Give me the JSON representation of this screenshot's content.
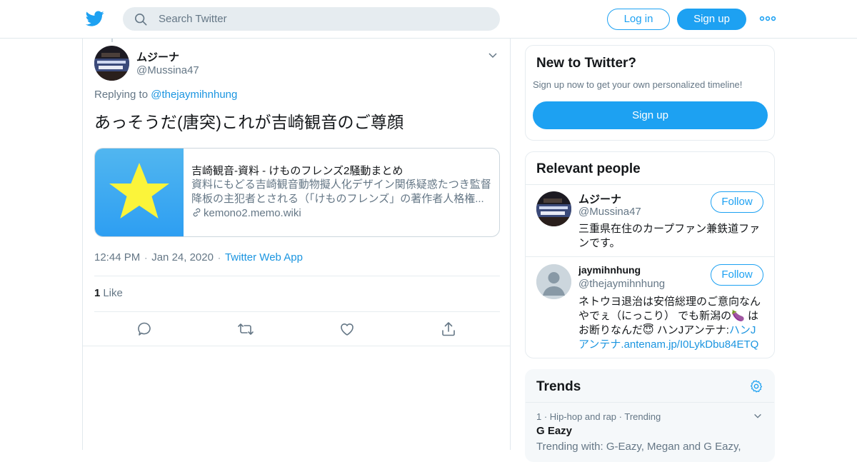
{
  "header": {
    "search_placeholder": "Search Twitter",
    "login_label": "Log in",
    "signup_label": "Sign up"
  },
  "tweet": {
    "author_name": "ムジーナ",
    "author_handle": "@Mussina47",
    "replying_prefix": "Replying to ",
    "replying_handle": "@thejaymihnhung",
    "text": "あっそうだ(唐突)これが吉崎観音のご尊顔",
    "card": {
      "title": "吉崎観音-資料 - けものフレンズ2騒動まとめ",
      "description": "資料にもどる吉崎観音動物擬人化デザイン関係疑惑たつき監督降板の主犯者とされる（「けものフレンズ」の著作者人格権...",
      "domain": "kemono2.memo.wiki"
    },
    "time": "12:44 PM",
    "date": "Jan 24, 2020",
    "via": "Twitter Web App",
    "like_count": "1",
    "like_label": "Like"
  },
  "sidebar": {
    "new_title": "New to Twitter?",
    "new_text": "Sign up now to get your own personalized timeline!",
    "new_signup_label": "Sign up",
    "people_title": "Relevant people",
    "people": [
      {
        "name": "ムジーナ",
        "handle": "@Mussina47",
        "follow_label": "Follow",
        "bio": "三重県在住のカープファン兼鉄道ファンです。"
      },
      {
        "name": "jaymihnhung",
        "handle": "@thejaymihnhung",
        "follow_label": "Follow",
        "bio_text": "ネトウヨ退治は安倍総理のご意向なんやでぇ（にっこり） でも新潟の🍆 はお断りなんだ😇 ハンJアンテナ:",
        "bio_link": "ハンJアンテナ.antenam.jp/I0LykDbu84ETQ"
      }
    ],
    "trends_title": "Trends",
    "trends": [
      {
        "rank": "1",
        "category": "Hip-hop and rap",
        "status": "Trending",
        "name": "G Eazy",
        "with": "Trending with: G-Eazy, Megan and G Eazy,"
      }
    ]
  },
  "colors": {
    "brand": "#1da1f2",
    "link": "#1b95e0",
    "muted": "#657786",
    "text": "#14171a",
    "border": "#e6ecf0"
  }
}
